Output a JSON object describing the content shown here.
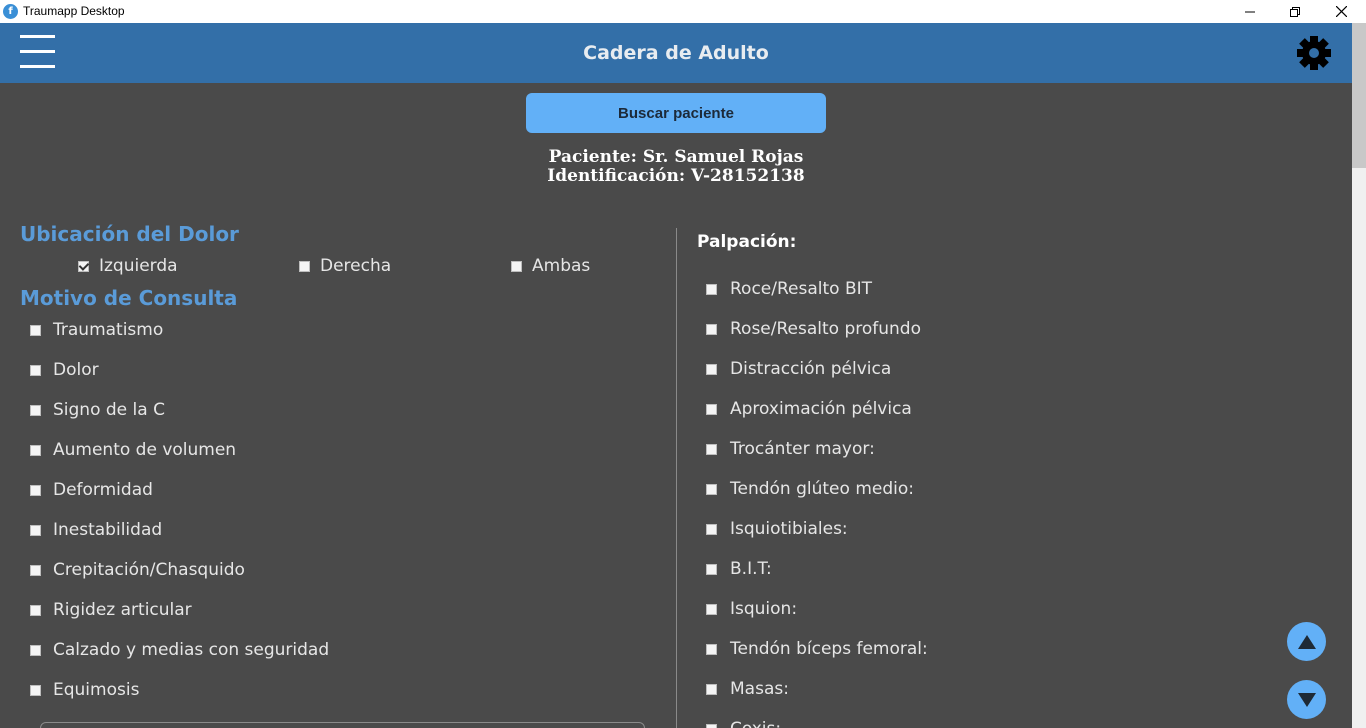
{
  "window": {
    "title": "Traumapp Desktop",
    "app_icon_glyph": "f"
  },
  "header": {
    "title": "Cadera de Adulto",
    "color": "#336fa8"
  },
  "search": {
    "button_label": "Buscar paciente",
    "color": "#62b0f7"
  },
  "patient": {
    "name_line": "Paciente: Sr. Samuel Rojas",
    "id_line": "Identificación: V-28152138"
  },
  "pain_location": {
    "title": "Ubicación del Dolor",
    "options": [
      {
        "label": "Izquierda",
        "checked": true
      },
      {
        "label": "Derecha",
        "checked": false
      },
      {
        "label": "Ambas",
        "checked": false
      }
    ]
  },
  "consult_reason": {
    "title": "Motivo de Consulta",
    "items": [
      {
        "label": "Traumatismo",
        "checked": false
      },
      {
        "label": "Dolor",
        "checked": false
      },
      {
        "label": "Signo de la C",
        "checked": false
      },
      {
        "label": "Aumento de volumen",
        "checked": false
      },
      {
        "label": "Deformidad",
        "checked": false
      },
      {
        "label": "Inestabilidad",
        "checked": false
      },
      {
        "label": "Crepitación/Chasquido",
        "checked": false
      },
      {
        "label": "Rigidez articular",
        "checked": false
      },
      {
        "label": "Calzado y medias con seguridad",
        "checked": false
      },
      {
        "label": "Equimosis",
        "checked": false
      }
    ]
  },
  "palpation": {
    "title": "Palpación:",
    "items": [
      {
        "label": "Roce/Resalto BIT",
        "checked": false
      },
      {
        "label": "Rose/Resalto profundo",
        "checked": false
      },
      {
        "label": "Distracción pélvica",
        "checked": false
      },
      {
        "label": "Aproximación pélvica",
        "checked": false
      },
      {
        "label": "Trocánter mayor:",
        "checked": false
      },
      {
        "label": "Tendón glúteo medio:",
        "checked": false
      },
      {
        "label": "Isquiotibiales:",
        "checked": false
      },
      {
        "label": "B.I.T:",
        "checked": false
      },
      {
        "label": "Isquion:",
        "checked": false
      },
      {
        "label": "Tendón bíceps femoral:",
        "checked": false
      },
      {
        "label": "Masas:",
        "checked": false
      },
      {
        "label": "Coxis:",
        "checked": false
      }
    ]
  },
  "icons": {
    "menu": "hamburger-icon",
    "settings": "gear-icon",
    "scroll_up": "arrow-up-icon",
    "scroll_down": "arrow-down-icon"
  }
}
